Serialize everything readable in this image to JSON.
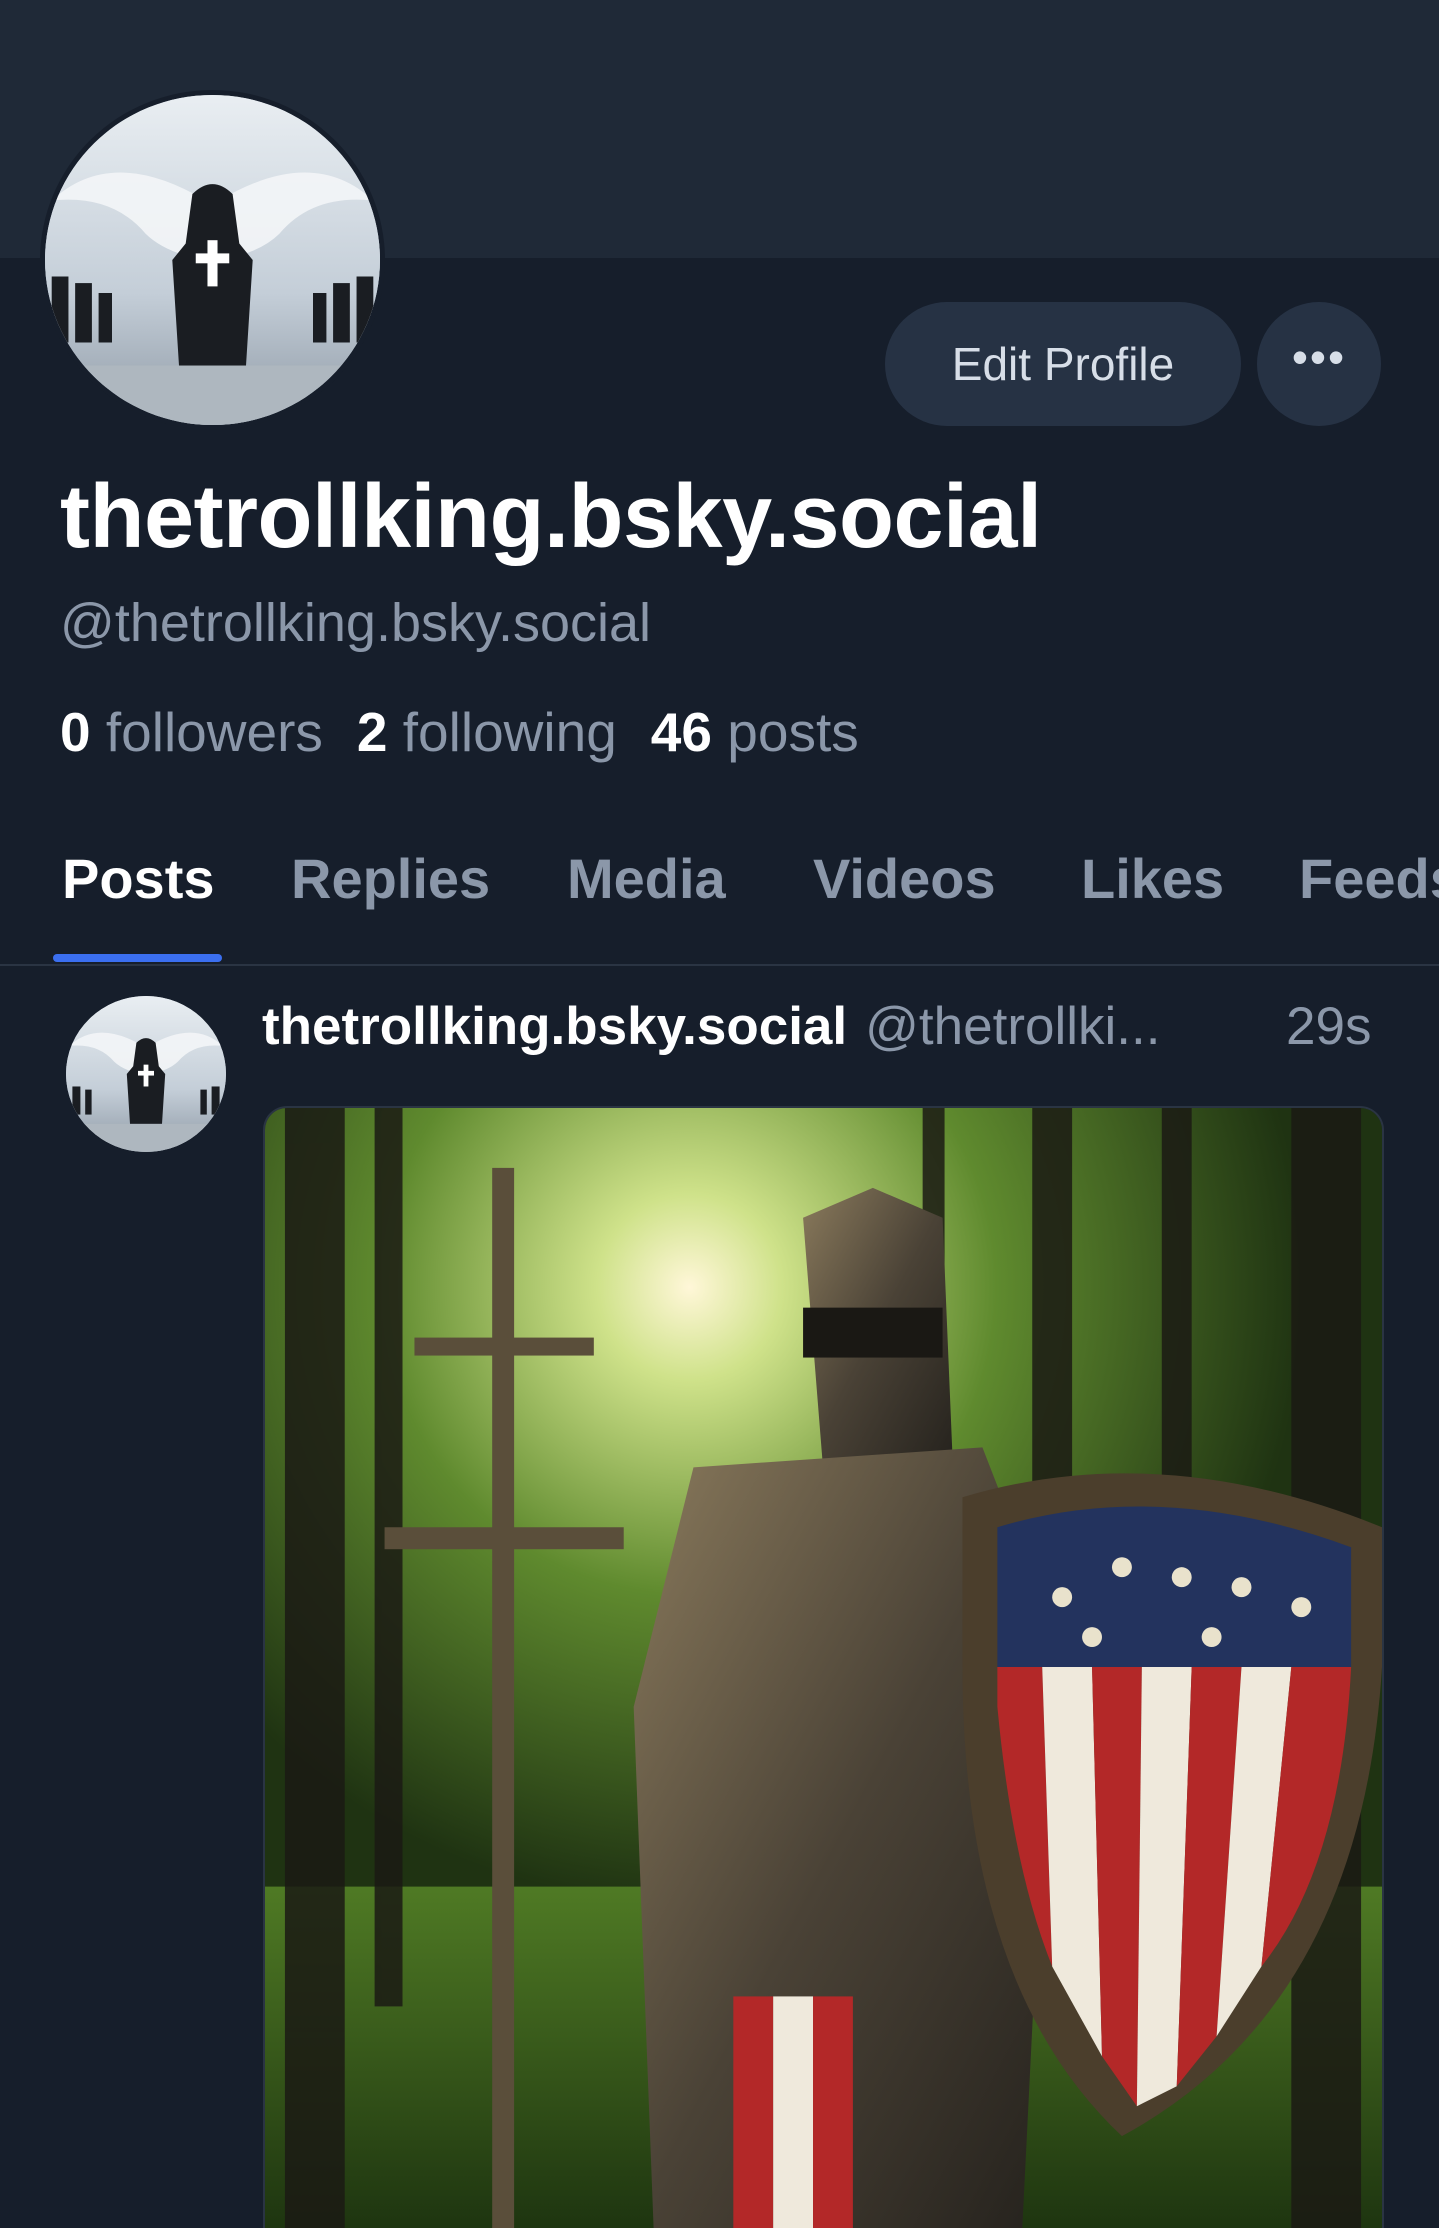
{
  "profile": {
    "display_name": "thetrollking.bsky.social",
    "handle": "@thetrollking.bsky.social",
    "avatar": "avatar-winged-knight-image",
    "stats": {
      "followers_count": "0",
      "followers_label": "followers",
      "following_count": "2",
      "following_label": "following",
      "posts_count": "46",
      "posts_label": "posts"
    }
  },
  "actions": {
    "edit_profile_label": "Edit Profile",
    "more_icon": "more-horizontal-icon",
    "more_label": "•••"
  },
  "tabs": [
    {
      "label": "Posts",
      "active": true
    },
    {
      "label": "Replies",
      "active": false
    },
    {
      "label": "Media",
      "active": false
    },
    {
      "label": "Videos",
      "active": false
    },
    {
      "label": "Likes",
      "active": false
    },
    {
      "label": "Feeds",
      "active": false
    }
  ],
  "post": {
    "author_name": "thetrollking.bsky.social",
    "author_handle": "@thetrollki...",
    "time": "29s",
    "image": "knight-with-american-flag-shield-in-forest"
  },
  "colors": {
    "background": "#161e2b",
    "banner": "#1f2937",
    "button": "#263244",
    "muted_text": "#8b97a9",
    "accent": "#3b6ff0"
  }
}
